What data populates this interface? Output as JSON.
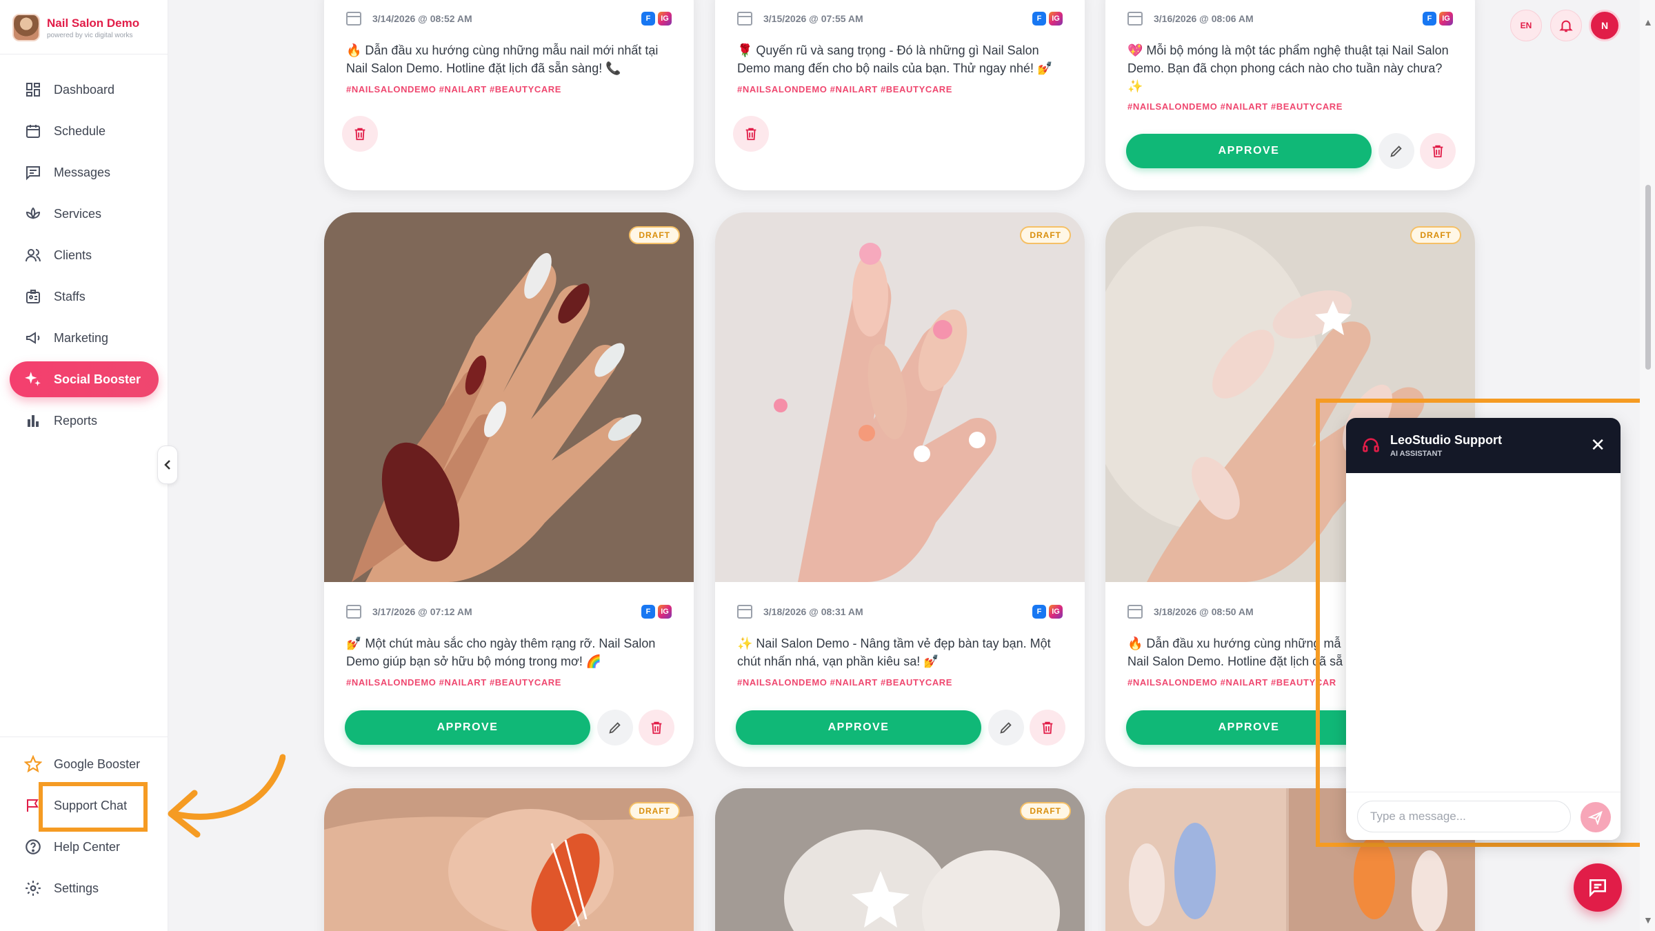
{
  "brand": {
    "name": "Nail Salon Demo",
    "sub": "powered by vic digital works"
  },
  "nav": [
    {
      "label": "Dashboard",
      "icon": "dashboard-icon"
    },
    {
      "label": "Schedule",
      "icon": "calendar-icon"
    },
    {
      "label": "Messages",
      "icon": "message-icon"
    },
    {
      "label": "Services",
      "icon": "lotus-icon"
    },
    {
      "label": "Clients",
      "icon": "users-icon"
    },
    {
      "label": "Staffs",
      "icon": "badge-icon"
    },
    {
      "label": "Marketing",
      "icon": "megaphone-icon"
    },
    {
      "label": "Social Booster",
      "icon": "sparkle-icon",
      "active": true
    },
    {
      "label": "Reports",
      "icon": "bar-chart-icon"
    }
  ],
  "bottom_nav": [
    {
      "label": "Google Booster",
      "icon": "star-icon"
    },
    {
      "label": "Support Chat",
      "icon": "flag-icon"
    },
    {
      "label": "Help Center",
      "icon": "help-icon"
    },
    {
      "label": "Settings",
      "icon": "gear-icon"
    }
  ],
  "topbar": {
    "lang": "EN",
    "user_initial": "N"
  },
  "draft_label": "DRAFT",
  "approve_label": "APPROVE",
  "cards": [
    {
      "date": "3/14/2026 @ 08:52 AM",
      "caption": "🔥 Dẫn đầu xu hướng cùng những mẫu nail mới nhất tại Nail Salon Demo. Hotline đặt lịch đã sẵn sàng! 📞",
      "tags": "#NAILSALONDEMO #NAILART #BEAUTYCARE"
    },
    {
      "date": "3/15/2026 @ 07:55 AM",
      "caption": "🌹 Quyến rũ và sang trọng - Đó là những gì Nail Salon Demo mang đến cho bộ nails của bạn. Thử ngay nhé! 💅",
      "tags": "#NAILSALONDEMO #NAILART #BEAUTYCARE"
    },
    {
      "date": "3/16/2026 @ 08:06 AM",
      "caption": "💖 Mỗi bộ móng là một tác phẩm nghệ thuật tại Nail Salon Demo. Bạn đã chọn phong cách nào cho tuần này chưa? ✨",
      "tags": "#NAILSALONDEMO #NAILART #BEAUTYCARE"
    },
    {
      "date": "3/17/2026 @ 07:12 AM",
      "caption": "💅 Một chút màu sắc cho ngày thêm rạng rỡ. Nail Salon Demo giúp bạn sở hữu bộ móng trong mơ! 🌈",
      "tags": "#NAILSALONDEMO #NAILART #BEAUTYCARE"
    },
    {
      "date": "3/18/2026 @ 08:31 AM",
      "caption": "✨ Nail Salon Demo - Nâng tầm vẻ đẹp bàn tay bạn. Một chút nhấn nhá, vạn phần kiêu sa! 💅",
      "tags": "#NAILSALONDEMO #NAILART #BEAUTYCARE"
    },
    {
      "date": "3/18/2026 @ 08:50 AM",
      "caption": "🔥 Dẫn đầu xu hướng cùng những mẫ Nail Salon Demo. Hotline đặt lịch đã sẵ",
      "tags": "#NAILSALONDEMO #NAILART #BEAUTYCAR"
    }
  ],
  "platforms": {
    "fb": "F",
    "ig": "IG"
  },
  "chat": {
    "title": "LeoStudio Support",
    "subtitle": "AI ASSISTANT",
    "close": "✕",
    "placeholder": "Type a message..."
  },
  "colors": {
    "accent": "#ef476f",
    "approve": "#10b877",
    "highlight": "#f59b23",
    "chat_header": "#141827"
  }
}
